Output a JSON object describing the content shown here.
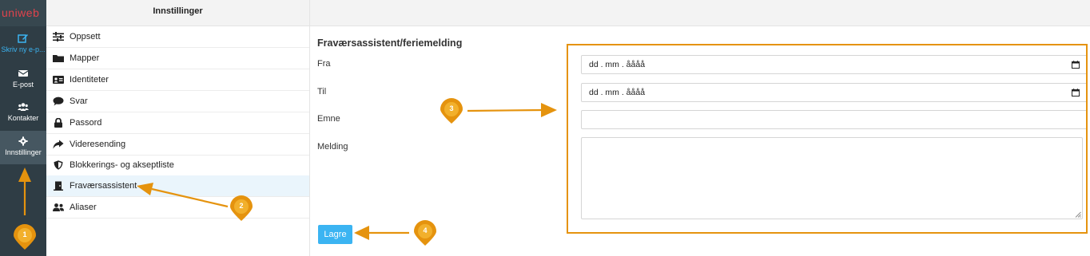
{
  "brand": {
    "logo_text": "uniweb",
    "logo_color": "#e0434c"
  },
  "nav": {
    "items": [
      {
        "label": "Skriv ny e-p...",
        "icon": "compose-icon"
      },
      {
        "label": "E-post",
        "icon": "envelope-icon"
      },
      {
        "label": "Kontakter",
        "icon": "contacts-icon"
      },
      {
        "label": "Innstillinger",
        "icon": "gear-icon",
        "active": true
      }
    ]
  },
  "settings_list": {
    "header": "Innstillinger",
    "items": [
      {
        "label": "Oppsett",
        "icon": "sliders-icon"
      },
      {
        "label": "Mapper",
        "icon": "folder-icon"
      },
      {
        "label": "Identiteter",
        "icon": "id-card-icon"
      },
      {
        "label": "Svar",
        "icon": "speech-bubble-icon"
      },
      {
        "label": "Passord",
        "icon": "lock-icon"
      },
      {
        "label": "Videresending",
        "icon": "forward-arrow-icon"
      },
      {
        "label": "Blokkerings- og akseptliste",
        "icon": "shield-icon"
      },
      {
        "label": "Fraværsassistent",
        "icon": "door-icon",
        "active": true
      },
      {
        "label": "Aliaser",
        "icon": "users-icon"
      }
    ]
  },
  "form": {
    "title": "Fraværsassistent/feriemelding",
    "from_label": "Fra",
    "from_value": "dd . mm . åååå",
    "to_label": "Til",
    "to_value": "dd . mm . åååå",
    "subject_label": "Emne",
    "subject_value": "",
    "message_label": "Melding",
    "message_value": "",
    "save_label": "Lagre"
  },
  "annotations": {
    "color": "#e5930e",
    "markers": [
      "1",
      "2",
      "3",
      "4"
    ]
  },
  "colors": {
    "nav_bg": "#2f3d45",
    "accent": "#3bb4f2",
    "active_row": "#eaf5fc"
  }
}
